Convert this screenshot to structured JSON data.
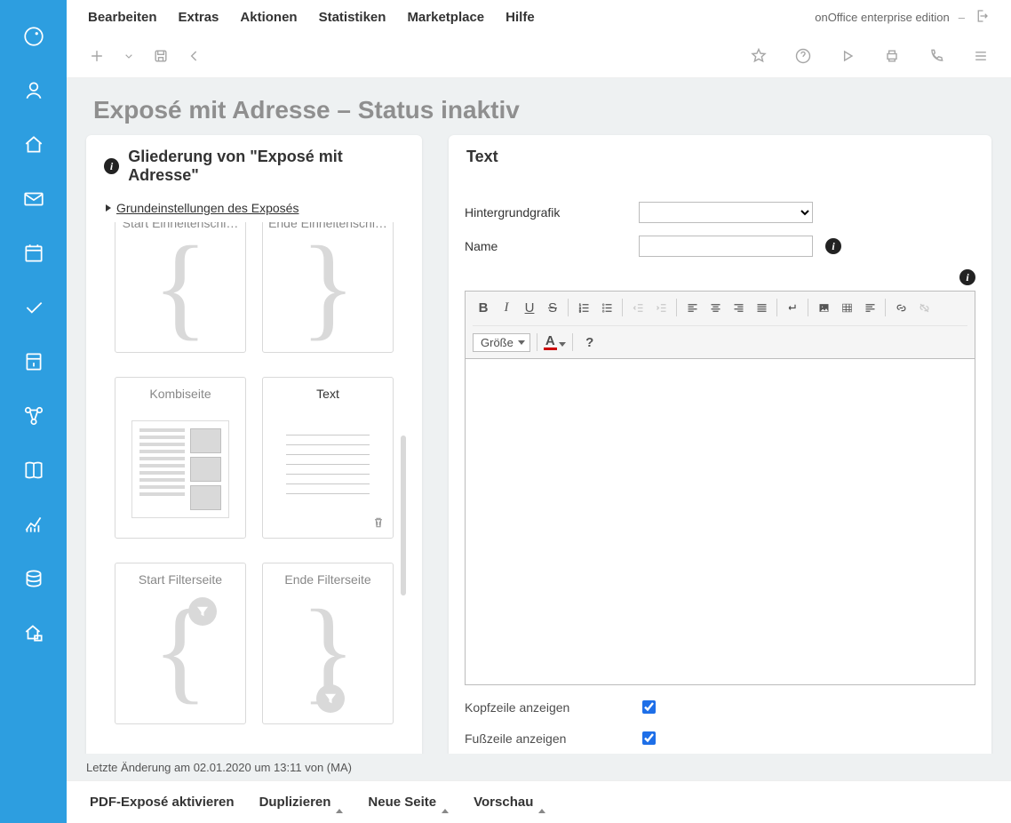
{
  "topmenu": {
    "items": [
      "Bearbeiten",
      "Extras",
      "Aktionen",
      "Statistiken",
      "Marketplace",
      "Hilfe"
    ]
  },
  "brand": "onOffice enterprise edition",
  "pageTitle": "Exposé mit Adresse – Status inaktiv",
  "leftCard": {
    "title": "Gliederung von \"Exposé mit Adresse\"",
    "settingsLink": "Grundeinstellungen des Exposés",
    "pages": {
      "p0": "Start Einheitenschl…",
      "p1": "Ende Einheitenschl…",
      "p2": "Kombiseite",
      "p3": "Text",
      "p4": "Start Filterseite",
      "p5": "Ende Filterseite"
    }
  },
  "rightCard": {
    "title": "Text",
    "labels": {
      "background": "Hintergrundgrafik",
      "name": "Name",
      "sizeLabel": "Größe",
      "header": "Kopfzeile anzeigen",
      "footer": "Fußzeile anzeigen"
    },
    "values": {
      "headerChecked": true,
      "footerChecked": true
    }
  },
  "status": "Letzte Änderung am 02.01.2020 um 13:11 von (MA)",
  "bottom": {
    "activate": "PDF-Exposé aktivieren",
    "duplicate": "Duplizieren",
    "newPage": "Neue Seite",
    "preview": "Vorschau"
  }
}
